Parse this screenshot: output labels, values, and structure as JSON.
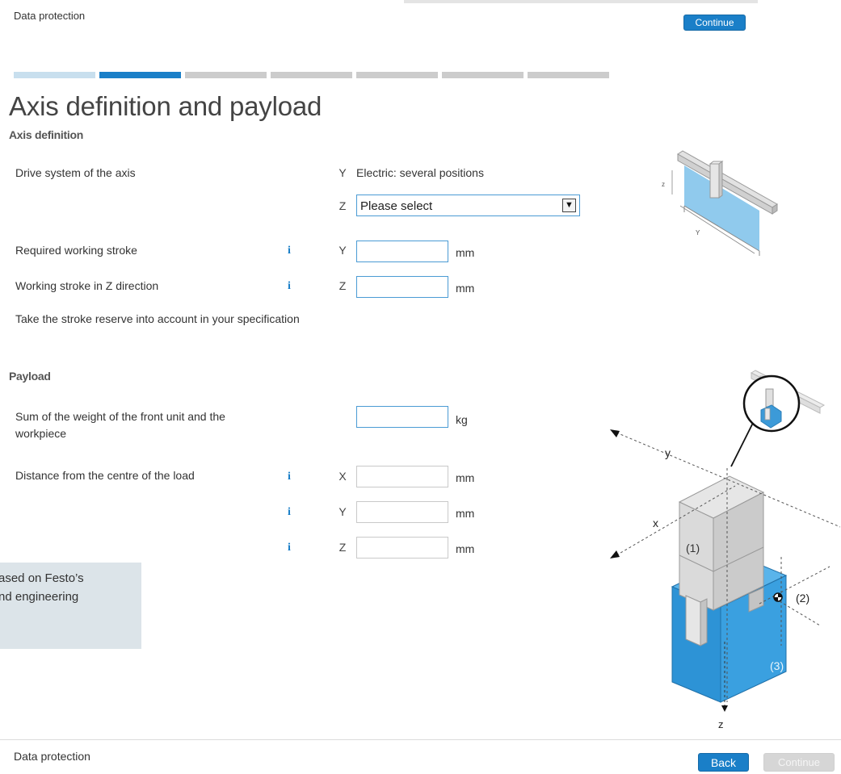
{
  "header": {
    "data_protection": "Data protection",
    "continue_label": "Continue"
  },
  "progress": {
    "total_steps": 7,
    "current_step": 2,
    "colors": {
      "done": "#c8dfee",
      "current": "#1a7fc8",
      "todo": "#cccccc"
    }
  },
  "page": {
    "title": "Axis definition and payload"
  },
  "axis_definition": {
    "heading": "Axis definition",
    "drive_system": {
      "label": "Drive system of the axis",
      "y_axis": "Y",
      "y_value": "Electric: several positions",
      "z_axis": "Z",
      "z_select_value": "Please select"
    },
    "working_stroke": {
      "label": "Required working stroke",
      "axis": "Y",
      "value": "",
      "unit": "mm"
    },
    "working_stroke_z": {
      "label": "Working stroke in Z direction",
      "axis": "Z",
      "value": "",
      "unit": "mm"
    },
    "stroke_note": "Take the stroke reserve into account in your specification",
    "info_glyph": "i"
  },
  "diagram_top": {
    "label_z": "z",
    "label_y": "Y"
  },
  "payload": {
    "heading": "Payload",
    "weight": {
      "label_line1": "Sum of the weight of the front unit and the",
      "label_line2": "workpiece",
      "value": "",
      "unit": "kg"
    },
    "distance": {
      "label": "Distance from the centre of the load",
      "rows": [
        {
          "axis": "X",
          "value": "",
          "unit": "mm"
        },
        {
          "axis": "Y",
          "value": "",
          "unit": "mm"
        },
        {
          "axis": "Z",
          "value": "",
          "unit": "mm"
        }
      ]
    }
  },
  "diagram_bottom": {
    "label_y": "y",
    "label_x": "x",
    "label_z": "z",
    "label_1": "(1)",
    "label_2": "(2)",
    "label_3": "(3)"
  },
  "note_box": {
    "line1": "ased on Festo’s",
    "line2": "nd engineering"
  },
  "footer": {
    "data_protection": "Data protection",
    "back_label": "Back",
    "continue_label": "Continue"
  }
}
